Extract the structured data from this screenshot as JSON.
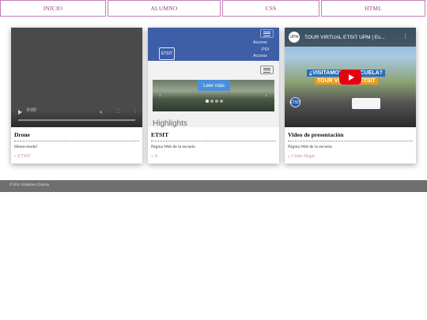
{
  "nav": {
    "items": [
      "INICIO",
      "ALUMNO",
      "CSS",
      "HTML"
    ]
  },
  "cards": [
    {
      "title": "Drone",
      "description": "Hemo-model",
      "link": "» ETSIT",
      "media": {
        "type": "video",
        "time": "0:00"
      }
    },
    {
      "title": "ETSIT",
      "description": "Página Web de la escuela",
      "link": "» Ir",
      "media": {
        "type": "webpage",
        "links": [
          "Access",
          "PDI",
          "Access"
        ],
        "button": "Leer más",
        "heading": "Highlights",
        "logo": "ETSIT"
      }
    },
    {
      "title": "Video de presentación",
      "description": "Página Web de la escuela",
      "link": "» Cómo llegar",
      "media": {
        "type": "youtube",
        "video_title": "TOUR VIRTUAL ETSIT UPM | Es...",
        "overlay_line1": "¿VISITAMOS LA ESCUELA?",
        "overlay_line2": "TOUR VIRTUAL ETSIT",
        "channel_badge": "UPM",
        "corner_badge": "ETSIT"
      }
    }
  ],
  "footer": {
    "text": "© Eric Gutiérrez Chacón"
  },
  "colors": {
    "accent": "#a0378e",
    "nav_border": "#c27fb4",
    "link": "#c98bb8",
    "footer_bg": "#6f6f6f"
  }
}
